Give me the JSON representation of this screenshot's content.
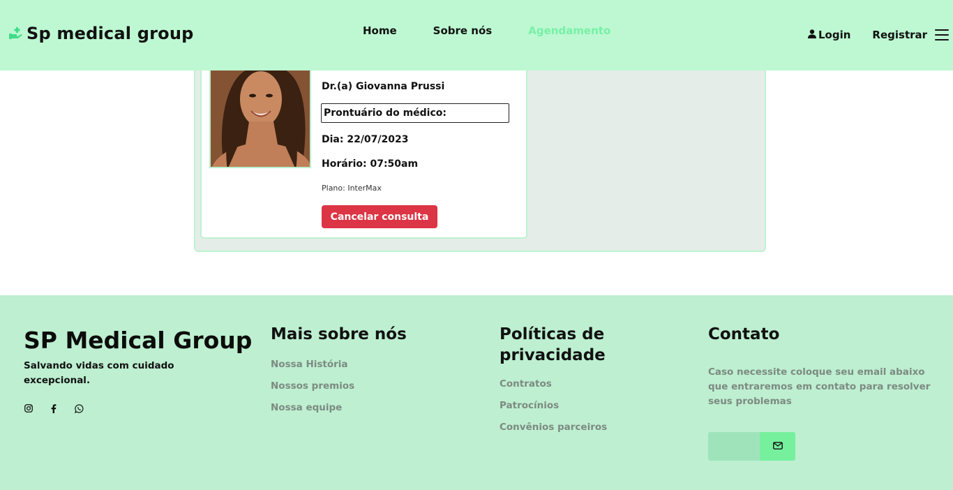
{
  "header": {
    "brand": "Sp medical group",
    "nav": [
      {
        "label": "Home"
      },
      {
        "label": "Sobre nós"
      },
      {
        "label": "Agendamento",
        "active": true
      }
    ],
    "login_label": "Login",
    "register_label": "Registrar"
  },
  "appointment": {
    "doctor": "Dr.(a) Giovanna Prussi",
    "prontuario_label": "Prontuário do médico:",
    "date": "Dia: 22/07/2023",
    "time": "Horário: 07:50am",
    "plan": "Plano: InterMax",
    "cancel_label": "Cancelar consulta"
  },
  "footer": {
    "title": "SP Medical Group",
    "tagline": "Salvando vidas com cuidado excepcional.",
    "socials": [
      "instagram-icon",
      "facebook-icon",
      "whatsapp-icon"
    ],
    "about": {
      "heading": "Mais sobre nós",
      "links": [
        "Nossa História",
        "Nossos premios",
        "Nossa equipe"
      ]
    },
    "policies": {
      "heading": "Políticas de privacidade",
      "links": [
        "Contratos",
        "Patrocínios",
        "Convênios parceiros"
      ]
    },
    "contact": {
      "heading": "Contato",
      "text": "Caso necessite coloque seu email abaixo que entraremos em contato para resolver seus problemas",
      "email_value": ""
    }
  },
  "colors": {
    "header_bg": "#bdf8d2",
    "active_nav": "#77f0a6",
    "cancel_button": "#dc3545",
    "footer_bg": "#bdefd0"
  }
}
